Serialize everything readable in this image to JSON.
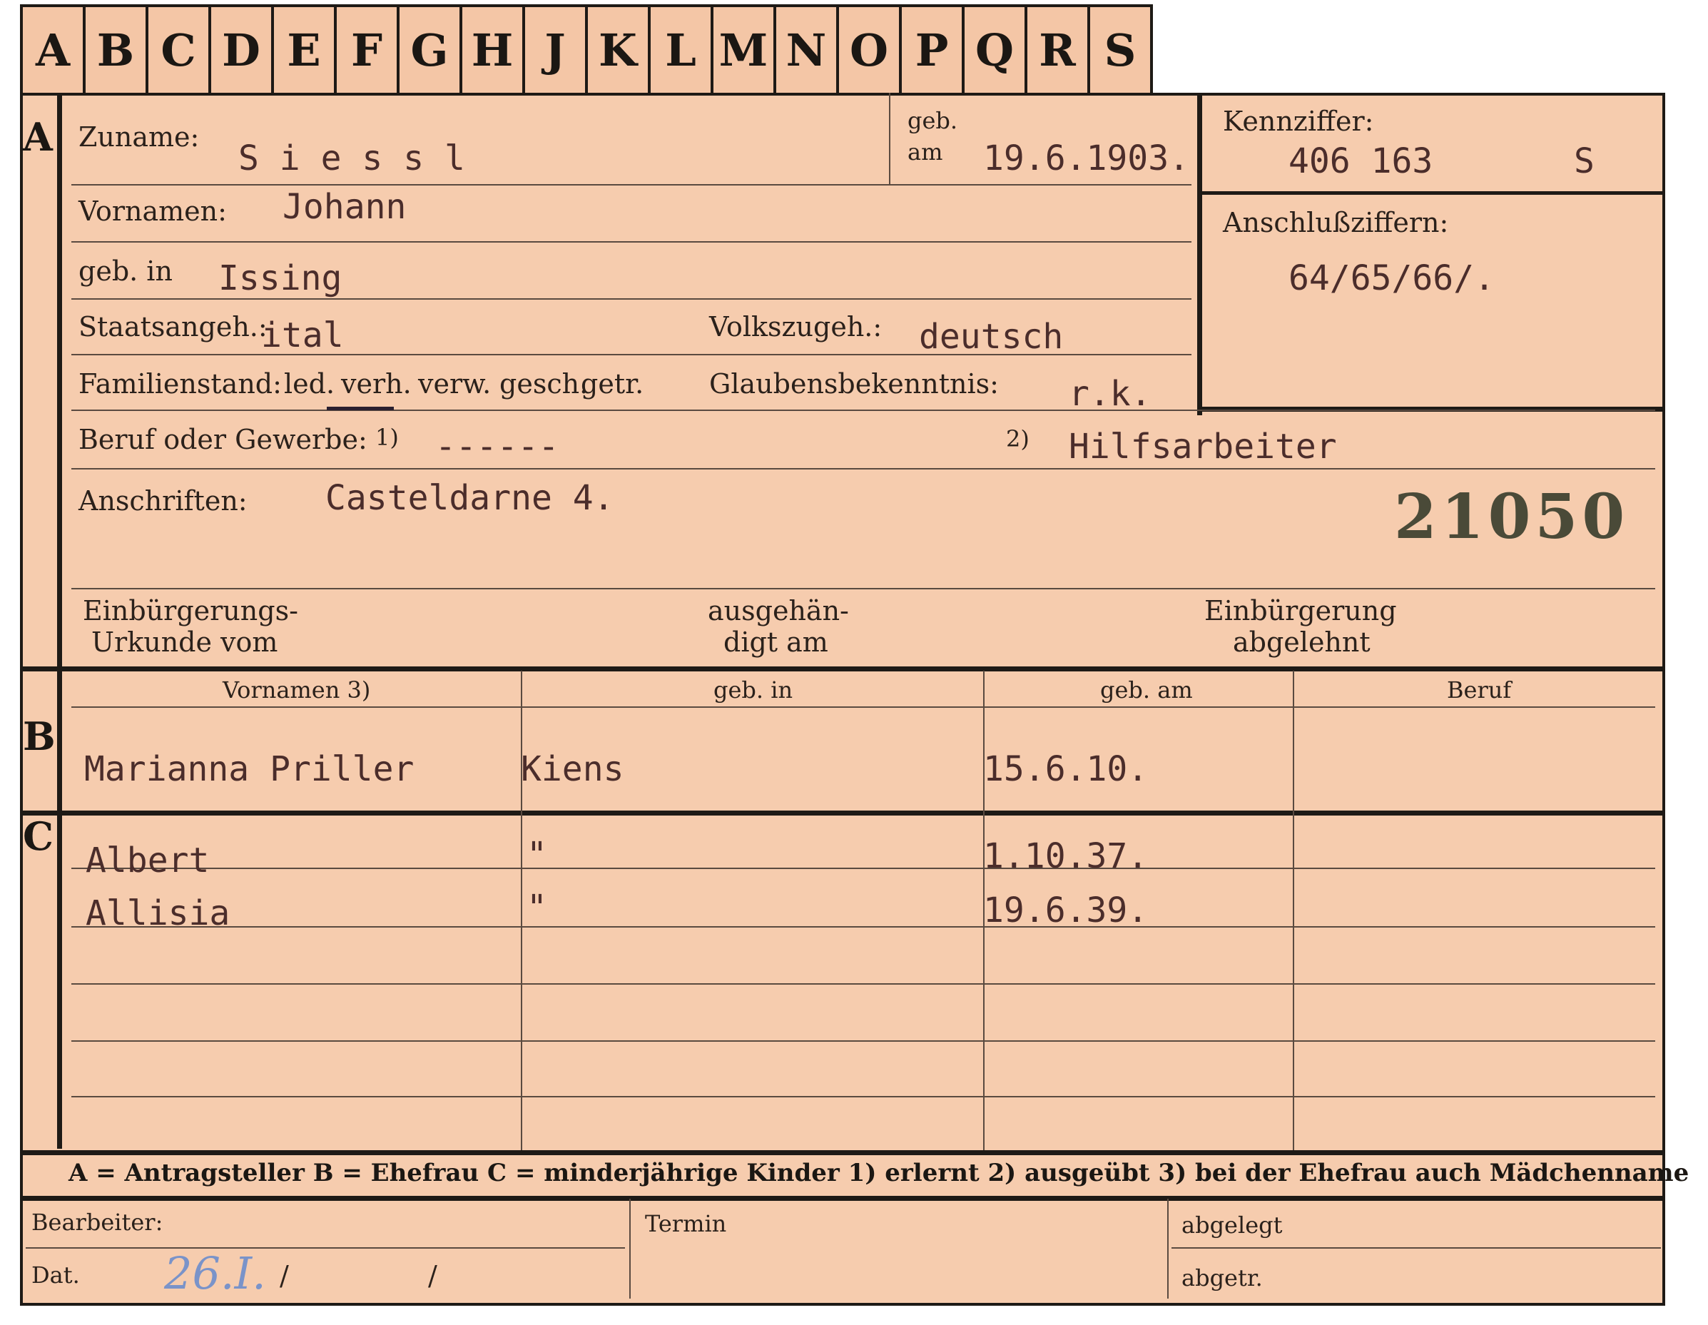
{
  "tabs": [
    "A",
    "B",
    "C",
    "D",
    "E",
    "F",
    "G",
    "H",
    "J",
    "K",
    "L",
    "M",
    "N",
    "O",
    "P",
    "Q",
    "R",
    "S"
  ],
  "sections": {
    "a": "A",
    "b": "B",
    "c": "C"
  },
  "applicant": {
    "zuname_label": "Zuname:",
    "zuname": "S i e s s l",
    "geb_label": "geb.",
    "am_label": "am",
    "geb_am": "19.6.1903.",
    "vornamen_label": "Vornamen:",
    "vornamen": "Johann",
    "geb_in_label": "geb. in",
    "geb_in": "Issing",
    "staatsangeh_label": "Staatsangeh.:",
    "staatsangeh": "ital",
    "volkszugeh_label": "Volkszugeh.:",
    "volkszugeh": "deutsch",
    "familienstand_label": "Familienstand:",
    "familienstand_options": [
      "led.",
      "verh.",
      "verw.",
      "gesch.",
      "getr."
    ],
    "glaubens_label": "Glaubensbekenntnis:",
    "glaubens": "r.k.",
    "beruf_label": "Beruf oder Gewerbe:",
    "beruf_note1": "1)",
    "beruf_value1": "------",
    "beruf_note2": "2)",
    "beruf_value2": "Hilfsarbeiter",
    "anschriften_label": "Anschriften:",
    "anschriften": "Casteldarne 4.",
    "stamp_number": "21050",
    "einb_label1": "Einbürgerungs-",
    "einb_label2": "Urkunde vom",
    "ausgehaen_label1": "ausgehän-",
    "ausgehaen_label2": "digt am",
    "einb_abgelehnt1": "Einbürgerung",
    "einb_abgelehnt2": "abgelehnt"
  },
  "kennziffer": {
    "label": "Kennziffer:",
    "value": "406 163",
    "letter": "S",
    "anschluss_label": "Anschlußziffern:",
    "anschluss_value": "64/65/66/."
  },
  "family_table": {
    "headers": [
      "Vornamen 3)",
      "geb. in",
      "geb. am",
      "Beruf"
    ],
    "spouse": {
      "name": "Marianna Priller",
      "geb_in": "Kiens",
      "geb_am": "15.6.10.",
      "beruf": ""
    },
    "children": [
      {
        "name": "Albert",
        "geb_in": "\"",
        "geb_am": "1.10.37.",
        "beruf": ""
      },
      {
        "name": "Allisia",
        "geb_in": "\"",
        "geb_am": "19.6.39.",
        "beruf": ""
      }
    ]
  },
  "legend": "A = Antragsteller   B = Ehefrau   C = minderjährige Kinder   1) erlernt   2) ausgeübt   3) bei der Ehefrau auch Mädchenname",
  "footer": {
    "bearbeiter_label": "Bearbeiter:",
    "dat_label": "Dat.",
    "dat_value": "26.I.",
    "dat_slash1": "/",
    "dat_slash2": "/",
    "termin_label": "Termin",
    "abgelegt_label": "abgelegt",
    "abgetr_label": "abgetr."
  }
}
